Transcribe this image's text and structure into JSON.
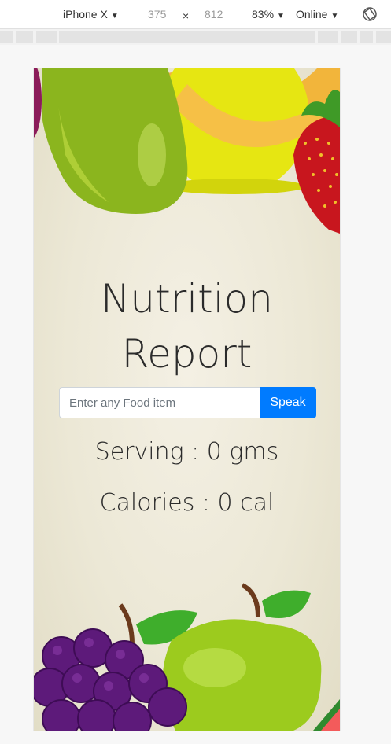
{
  "devtools": {
    "device": "iPhone X",
    "width": "375",
    "times": "×",
    "height": "812",
    "zoom": "83%",
    "network": "Online",
    "caret": "▼",
    "rotate_icon": "rotate-icon"
  },
  "app": {
    "title_line1": "Nutrition",
    "title_line2": "Report",
    "search": {
      "placeholder": "Enter any Food item",
      "value": ""
    },
    "speak_label": "Speak",
    "serving_text": "Serving : 0 gms",
    "calories_text": "Calories : 0 cal"
  },
  "colors": {
    "accent": "#007bff",
    "background": "#ece8d6"
  }
}
